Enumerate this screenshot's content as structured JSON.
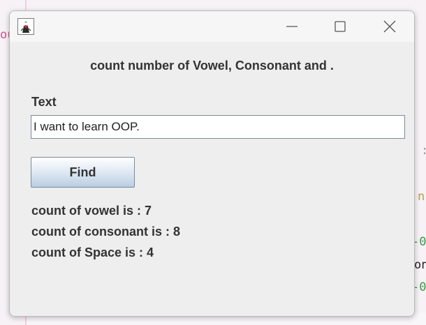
{
  "window": {
    "title": "",
    "app_icon": "java-duke-icon"
  },
  "controls": {
    "minimize_icon": "minimize-icon",
    "maximize_icon": "maximize-icon",
    "close_icon": "close-icon"
  },
  "form": {
    "heading": "count number of Vowel, Consonant and .",
    "text_label": "Text",
    "text_value": "I want to learn OOP.",
    "find_label": "Find"
  },
  "results": {
    "vowel": "count of vowel is : 7",
    "consonant": "count of consonant is : 8",
    "space": "count of Space is : 4"
  },
  "background_fragments": {
    "left_fragment": "ou",
    "right_colon": ":",
    "right_n": "n",
    "right_zero_1": "-0",
    "right_on": "on",
    "right_zero_2": "-0"
  },
  "colors": {
    "window_bg": "#eeeeee",
    "text": "#333333",
    "button_gradient_bottom": "#b9cde2"
  }
}
